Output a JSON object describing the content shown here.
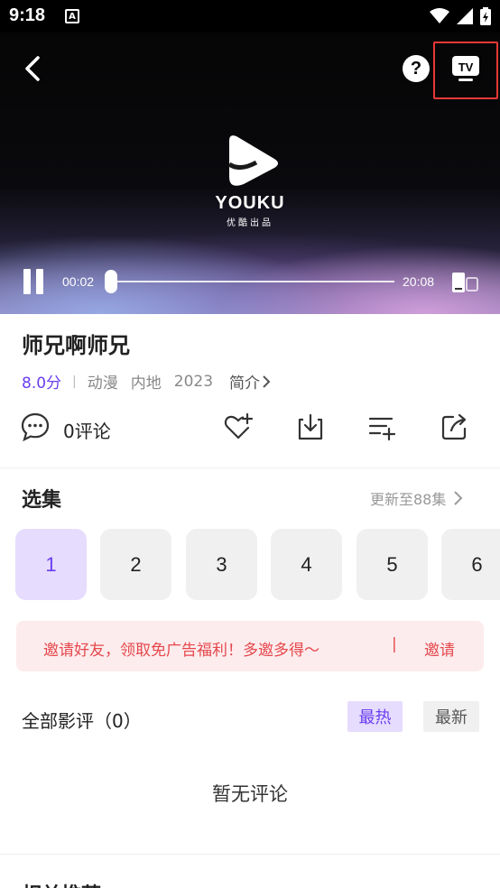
{
  "status_bar": {
    "time": "9:18",
    "notif": "A"
  },
  "player": {
    "logo_text": "YOUKU",
    "logo_sub": "优酷出品",
    "time_current": "00:02",
    "time_total": "20:08",
    "progress": 0.0
  },
  "show": {
    "title": "师兄啊师兄",
    "score": "8.0分",
    "separator": "|",
    "tags": [
      "动漫",
      "内地",
      "2023"
    ],
    "intro": "简介"
  },
  "actions": {
    "comment_label": "0评论"
  },
  "episodes": {
    "title": "选集",
    "update": "更新至88集",
    "items": [
      "1",
      "2",
      "3",
      "4",
      "5",
      "6"
    ],
    "selected": "1"
  },
  "invite": {
    "text": "邀请好友，领取免广告福利！多邀多得～",
    "separator": "|",
    "button": "邀请"
  },
  "reviews": {
    "title": "全部影评（0）",
    "sort_hot": "最热",
    "sort_new": "最新",
    "empty": "暂无评论"
  },
  "more": {
    "title": "相关推荐"
  },
  "colors": {
    "accent": "#6a3df0",
    "accent_bg": "#e6dcfd",
    "invite_red": "#e5484d",
    "invite_bg": "#fdeced",
    "highlight": "#e53935"
  }
}
